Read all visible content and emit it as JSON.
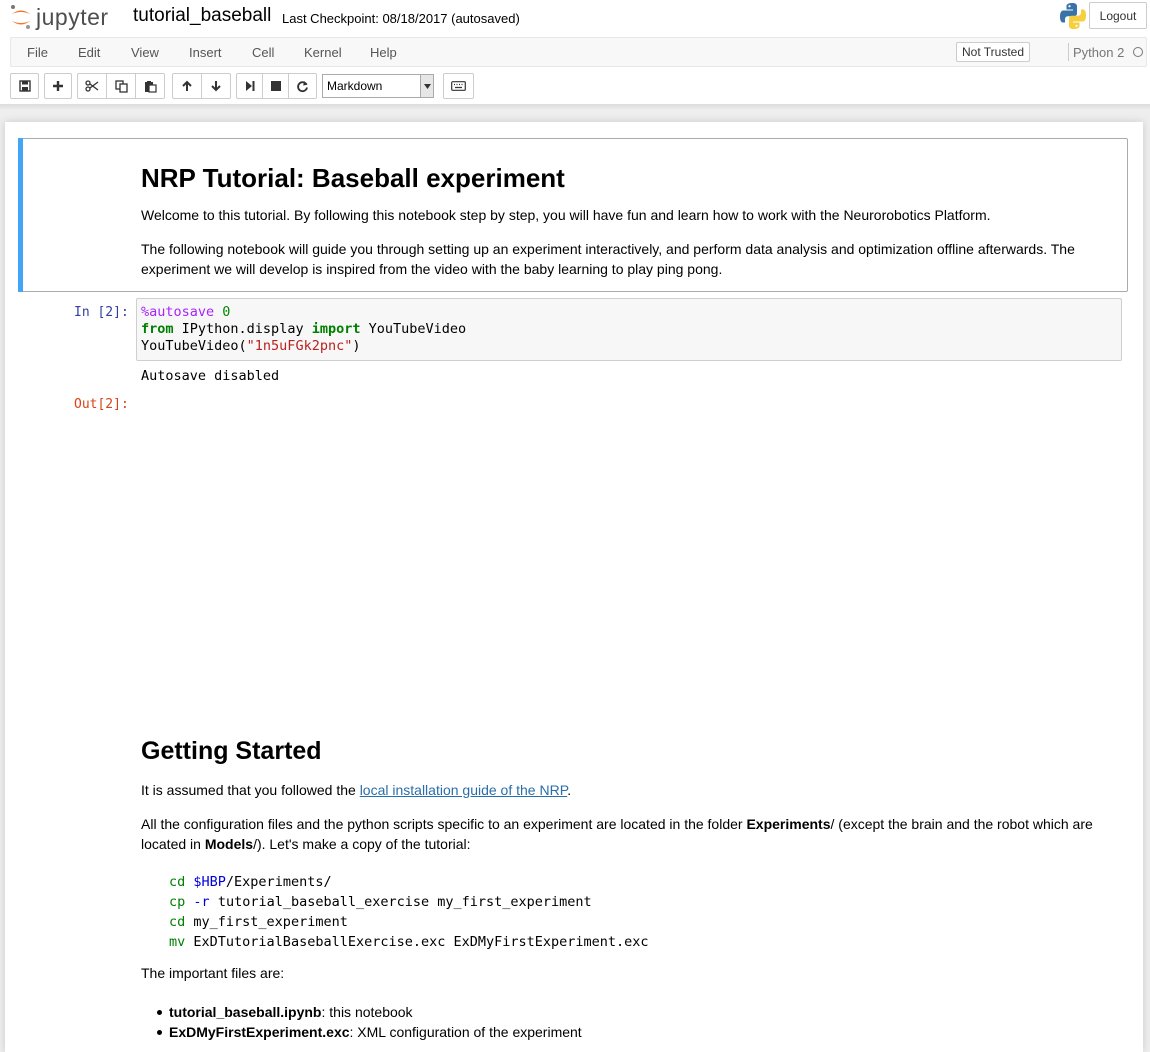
{
  "header": {
    "logo_text": "jupyter",
    "notebook_name": "tutorial_baseball",
    "checkpoint": "Last Checkpoint: 08/18/2017 (autosaved)",
    "logout_label": "Logout"
  },
  "menubar": {
    "items": [
      "File",
      "Edit",
      "View",
      "Insert",
      "Cell",
      "Kernel",
      "Help"
    ],
    "trust_label": "Not Trusted",
    "kernel_name": "Python 2"
  },
  "toolbar": {
    "icons": [
      "save-icon",
      "plus-icon",
      "cut-icon",
      "copy-icon",
      "paste-icon",
      "arrow-up-icon",
      "arrow-down-icon",
      "run-icon",
      "stop-icon",
      "restart-icon",
      "keyboard-icon"
    ],
    "cell_type": "Markdown"
  },
  "cells": {
    "md1": {
      "title": "NRP Tutorial: Baseball experiment",
      "para1": "Welcome to this tutorial. By following this notebook step by step, you will have fun and learn how to work with the Neurorobotics Platform.",
      "para2": "The following notebook will guide you through setting up an experiment interactively, and perform data analysis and optimization offline afterwards. The experiment we will develop is inspired from the video with the baby learning to play ping pong."
    },
    "code1": {
      "prompt_in": "In [2]:",
      "line1_magic": "%autosave",
      "line1_num": "0",
      "line2_from": "from",
      "line2_module": "IPython.display",
      "line2_import": "import",
      "line2_name": "YouTubeVideo",
      "line3_call": "YouTubeVideo(",
      "line3_str": "\"1n5uFGk2pnc\"",
      "line3_close": ")",
      "stdout": "Autosave disabled",
      "prompt_out": "Out[2]:"
    },
    "md2": {
      "title": "Getting Started",
      "intro_before": "It is assumed that you followed the ",
      "intro_link": "local installation guide of the NRP",
      "intro_after": ".",
      "para_a": "All the configuration files and the python scripts specific to an experiment are located in the folder ",
      "para_b": "Experiments",
      "para_c": "/ (except the brain and the robot which are located in ",
      "para_d": "Models",
      "para_e": "/). Let's make a copy of the tutorial:",
      "shell": {
        "l1_cmd": "cd",
        "l1_var": "$HBP",
        "l1_rest": "/Experiments/",
        "l2_cmd": "cp",
        "l2_flag": "-r",
        "l2_rest": "tutorial_baseball_exercise my_first_experiment",
        "l3_cmd": "cd",
        "l3_rest": "my_first_experiment",
        "l4_cmd": "mv",
        "l4_rest": "ExDTutorialBaseballExercise.exc ExDMyFirstExperiment.exc"
      },
      "files_intro": "The important files are:",
      "files": [
        {
          "name": "tutorial_baseball.ipynb",
          "desc": ": this notebook"
        },
        {
          "name": "ExDMyFirstExperiment.exc",
          "desc": ": XML configuration of the experiment"
        }
      ]
    }
  }
}
